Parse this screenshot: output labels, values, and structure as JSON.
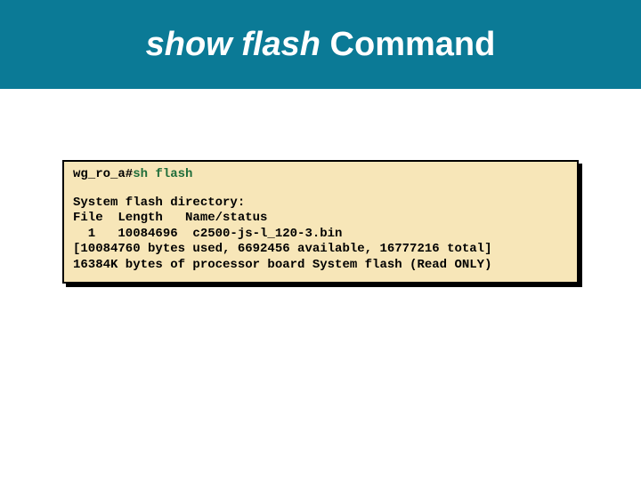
{
  "header": {
    "cmd": "show flash",
    "word": " Command"
  },
  "terminal": {
    "prompt": "wg_ro_a#",
    "command": "sh flash",
    "lines": {
      "l1": "System flash directory:",
      "l2": "File  Length   Name/status",
      "l3": "  1   10084696  c2500-js-l_120-3.bin",
      "l4": "[10084760 bytes used, 6692456 available, 16777216 total]",
      "l5": "16384K bytes of processor board System flash (Read ONLY)"
    }
  }
}
